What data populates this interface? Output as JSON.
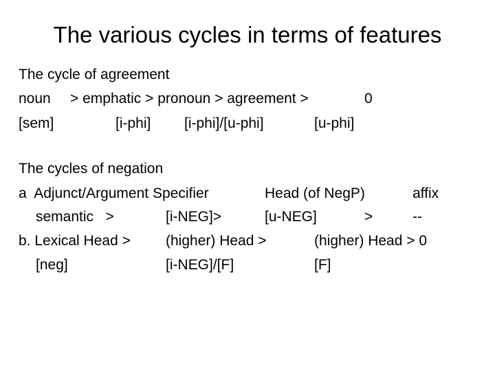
{
  "slide": {
    "title": "The various cycles in terms of features",
    "agreement": {
      "heading": "The cycle of agreement",
      "row1": [
        "noun",
        "> emphatic > pronoun > agreement >",
        "0"
      ],
      "row2": [
        "[sem]",
        "[i-phi]",
        "[i-phi]/[u-phi]",
        "[u-phi]"
      ]
    },
    "negation": {
      "heading": "The cycles of negation",
      "a": {
        "row1": [
          "a  Adjunct/Argument Specifier",
          "Head (of NegP)",
          "affix"
        ],
        "row2": [
          "semantic   >",
          "[i-NEG]>",
          "[u-NEG]",
          ">",
          "--"
        ]
      },
      "b": {
        "row1": [
          "b. Lexical Head >",
          "(higher) Head >",
          "(higher) Head > 0"
        ],
        "row2": [
          "[neg]",
          "[i-NEG]/[F]",
          "[F]"
        ]
      }
    }
  }
}
